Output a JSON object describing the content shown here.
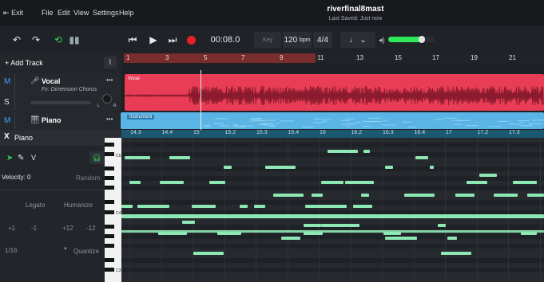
{
  "menu": {
    "exit": "Exit",
    "items": [
      "File",
      "Edit",
      "View",
      "Settings",
      "Help"
    ]
  },
  "project": {
    "title": "riverfinal8mast",
    "saved": "Last Saved: Just now"
  },
  "transport": {
    "time": "00:08.0",
    "key_label": "Key",
    "tempo": "120",
    "tempo_unit": "bpm",
    "meter": "4/4",
    "volume_level": 0.72
  },
  "ruler": {
    "bars": [
      "1",
      "3",
      "5",
      "7",
      "9",
      "11",
      "13",
      "15",
      "17",
      "19",
      "21"
    ]
  },
  "sidebar": {
    "add_track": "+ Add Track",
    "tracks": [
      {
        "mute": "M",
        "solo": "S",
        "name": "Vocal",
        "fx": "Fx: Dimension Chorus",
        "menu": "•••",
        "pan_l": "L",
        "pan_r": "R"
      },
      {
        "mute": "M",
        "name": "Piano",
        "menu": "•••"
      }
    ],
    "editor_title": "Piano",
    "editor_close": "X",
    "velocity": "Velocity: 0",
    "random": "Random",
    "legato": "Legato",
    "humanize": "Humanize",
    "transpose": [
      "+1",
      "-1",
      "+12",
      "-12"
    ],
    "grid_value": "1/16",
    "quantize": "Quantize"
  },
  "clips": {
    "vocal": "Vocal",
    "piano": "Instrument"
  },
  "pianoroll": {
    "ticks": [
      "14.3",
      "14.4",
      "15",
      "15.2",
      "15.3",
      "15.4",
      "16",
      "16.2",
      "16.3",
      "16.4",
      "17",
      "17.2",
      "17.3"
    ],
    "octaves": [
      "C5",
      "C4",
      "C3"
    ]
  },
  "colors": {
    "accent_red": "#e83d55",
    "accent_blue": "#5ab4e6",
    "note": "#8ee8b4",
    "record": "#e82020",
    "meter": "#2ee85a"
  }
}
